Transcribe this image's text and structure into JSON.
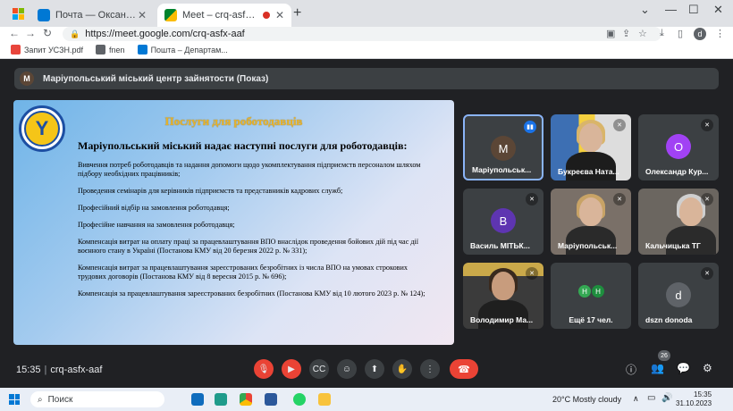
{
  "browser": {
    "tabs": [
      {
        "title": "Почта — Оксана Зуева — Outlook"
      },
      {
        "title": "Meet – crq-asfx-aaf"
      }
    ],
    "url": "https://meet.google.com/crq-asfx-aaf",
    "profile_letter": "d",
    "bookmarks": [
      "Запит УСЗН.pdf",
      "fnen",
      "Пошта – Департам..."
    ]
  },
  "meet": {
    "presenter_letter": "M",
    "presenter_label": "Маріупольський міський центр зайнятости (Показ)",
    "slide": {
      "title": "Послуги для роботодавців",
      "subtitle": "Маріупольський міський надає наступні послуги для роботодавців:",
      "paragraphs": [
        "Вивчення потреб роботодавців та надання допомоги щодо укомплектування підприємств персоналом шляхом підбору необхідних працівників;",
        "Проведення семінарів для керівників підприємств та представників кадрових служб;",
        "Професійний відбір на замовлення роботодавця;",
        "Професійне навчання на замовлення роботодавця;",
        "Компенсація витрат на оплату праці за працевлаштування ВПО внаслідок проведення бойових дій під час дії воєнного стану в Україні (Постанова КМУ від 20 березня 2022 р. № 331);",
        "Компенсація витрат за працевлаштування зареєстрованих безробітних із числа ВПО на умовах строкових трудових договорів (Постанова КМУ від 8 вересня 2015 р. № 696);",
        "Компенсація за працевлаштування зареєстрованих безробітних (Постанова КМУ від 10 лютого 2023 р. № 124);"
      ]
    },
    "participants": [
      {
        "name": "Маріупольськ...",
        "letter": "M",
        "color": "#5b4636"
      },
      {
        "name": "Букреєва Ната...",
        "letter": "",
        "color": ""
      },
      {
        "name": "Олександр Кур...",
        "letter": "O",
        "color": "#a142f4"
      },
      {
        "name": "Василь МІТЬК...",
        "letter": "B",
        "color": "#5e35b1"
      },
      {
        "name": "Маріупольськ...",
        "letter": "",
        "color": ""
      },
      {
        "name": "Кальчицька ТГ",
        "letter": "",
        "color": ""
      },
      {
        "name": "Володимир Ма...",
        "letter": "",
        "color": ""
      },
      {
        "name": "Ещё 17 чел.",
        "letter": "",
        "color": ""
      },
      {
        "name": "dszn donoda",
        "letter": "d",
        "color": "#5f6368"
      }
    ],
    "more_avatars": [
      "Н",
      "Н"
    ],
    "time": "15:35",
    "code": "crq-asfx-aaf",
    "participant_count": "26"
  },
  "taskbar": {
    "search_label": "Поиск",
    "weather": "20°C  Mostly cloudy",
    "time": "15:35",
    "date": "31.10.2023"
  }
}
